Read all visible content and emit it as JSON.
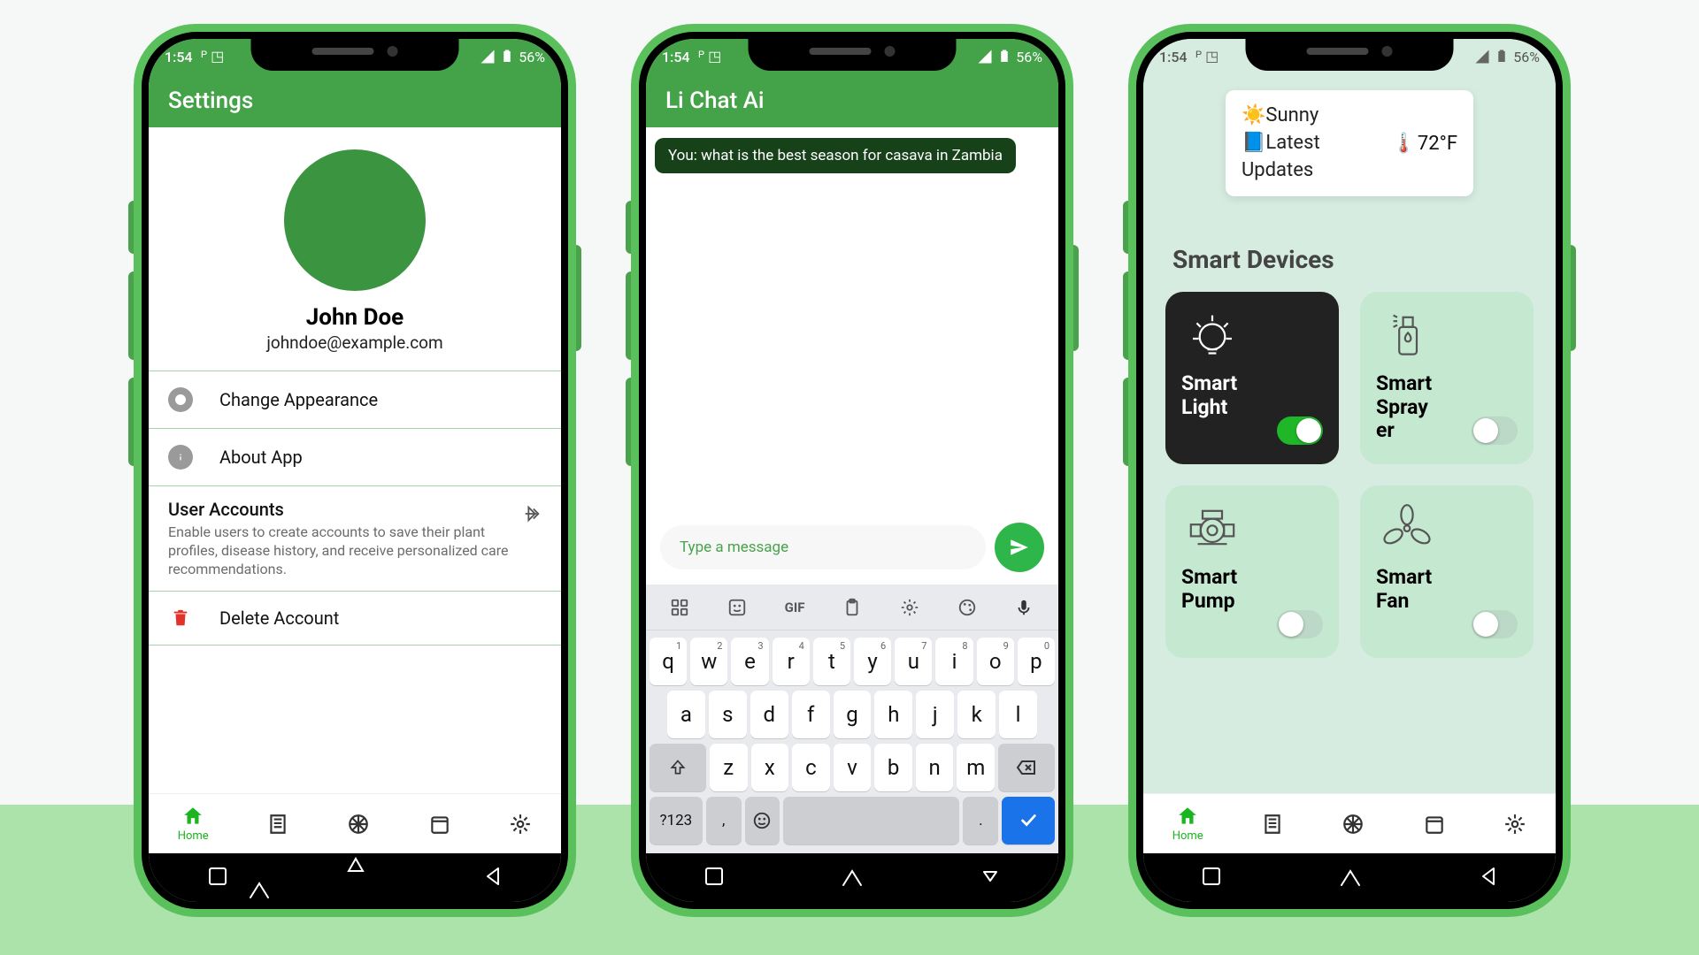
{
  "status": {
    "time": "1:54",
    "battery": "56%"
  },
  "settings": {
    "title": "Settings",
    "user_name": "John Doe",
    "user_email": "johndoe@example.com",
    "rows": {
      "appearance": "Change Appearance",
      "about": "About App",
      "accounts_title": "User Accounts",
      "accounts_desc": "Enable users to create accounts to save their plant profiles, disease history, and receive personalized care recommendations.",
      "delete": "Delete Account"
    }
  },
  "chat": {
    "title": "Li Chat Ai",
    "user_message": "You: what is the best season for casava in Zambia",
    "placeholder": "Type a message"
  },
  "smart": {
    "weather_condition": "Sunny",
    "weather_updates": "Latest Updates",
    "temperature": "72°F",
    "section": "Smart Devices",
    "devices": {
      "light": "Smart Light",
      "sprayer": "Smart Sprayer",
      "pump": "Smart Pump",
      "fan": "Smart Fan"
    }
  },
  "bottomnav": {
    "home": "Home"
  },
  "keyboard": {
    "row1": [
      {
        "k": "q",
        "s": "1"
      },
      {
        "k": "w",
        "s": "2"
      },
      {
        "k": "e",
        "s": "3"
      },
      {
        "k": "r",
        "s": "4"
      },
      {
        "k": "t",
        "s": "5"
      },
      {
        "k": "y",
        "s": "6"
      },
      {
        "k": "u",
        "s": "7"
      },
      {
        "k": "i",
        "s": "8"
      },
      {
        "k": "o",
        "s": "9"
      },
      {
        "k": "p",
        "s": "0"
      }
    ],
    "row2": [
      "a",
      "s",
      "d",
      "f",
      "g",
      "h",
      "j",
      "k",
      "l"
    ],
    "row3": [
      "z",
      "x",
      "c",
      "v",
      "b",
      "n",
      "m"
    ],
    "sym": "?123",
    "comma": ",",
    "period": "."
  }
}
